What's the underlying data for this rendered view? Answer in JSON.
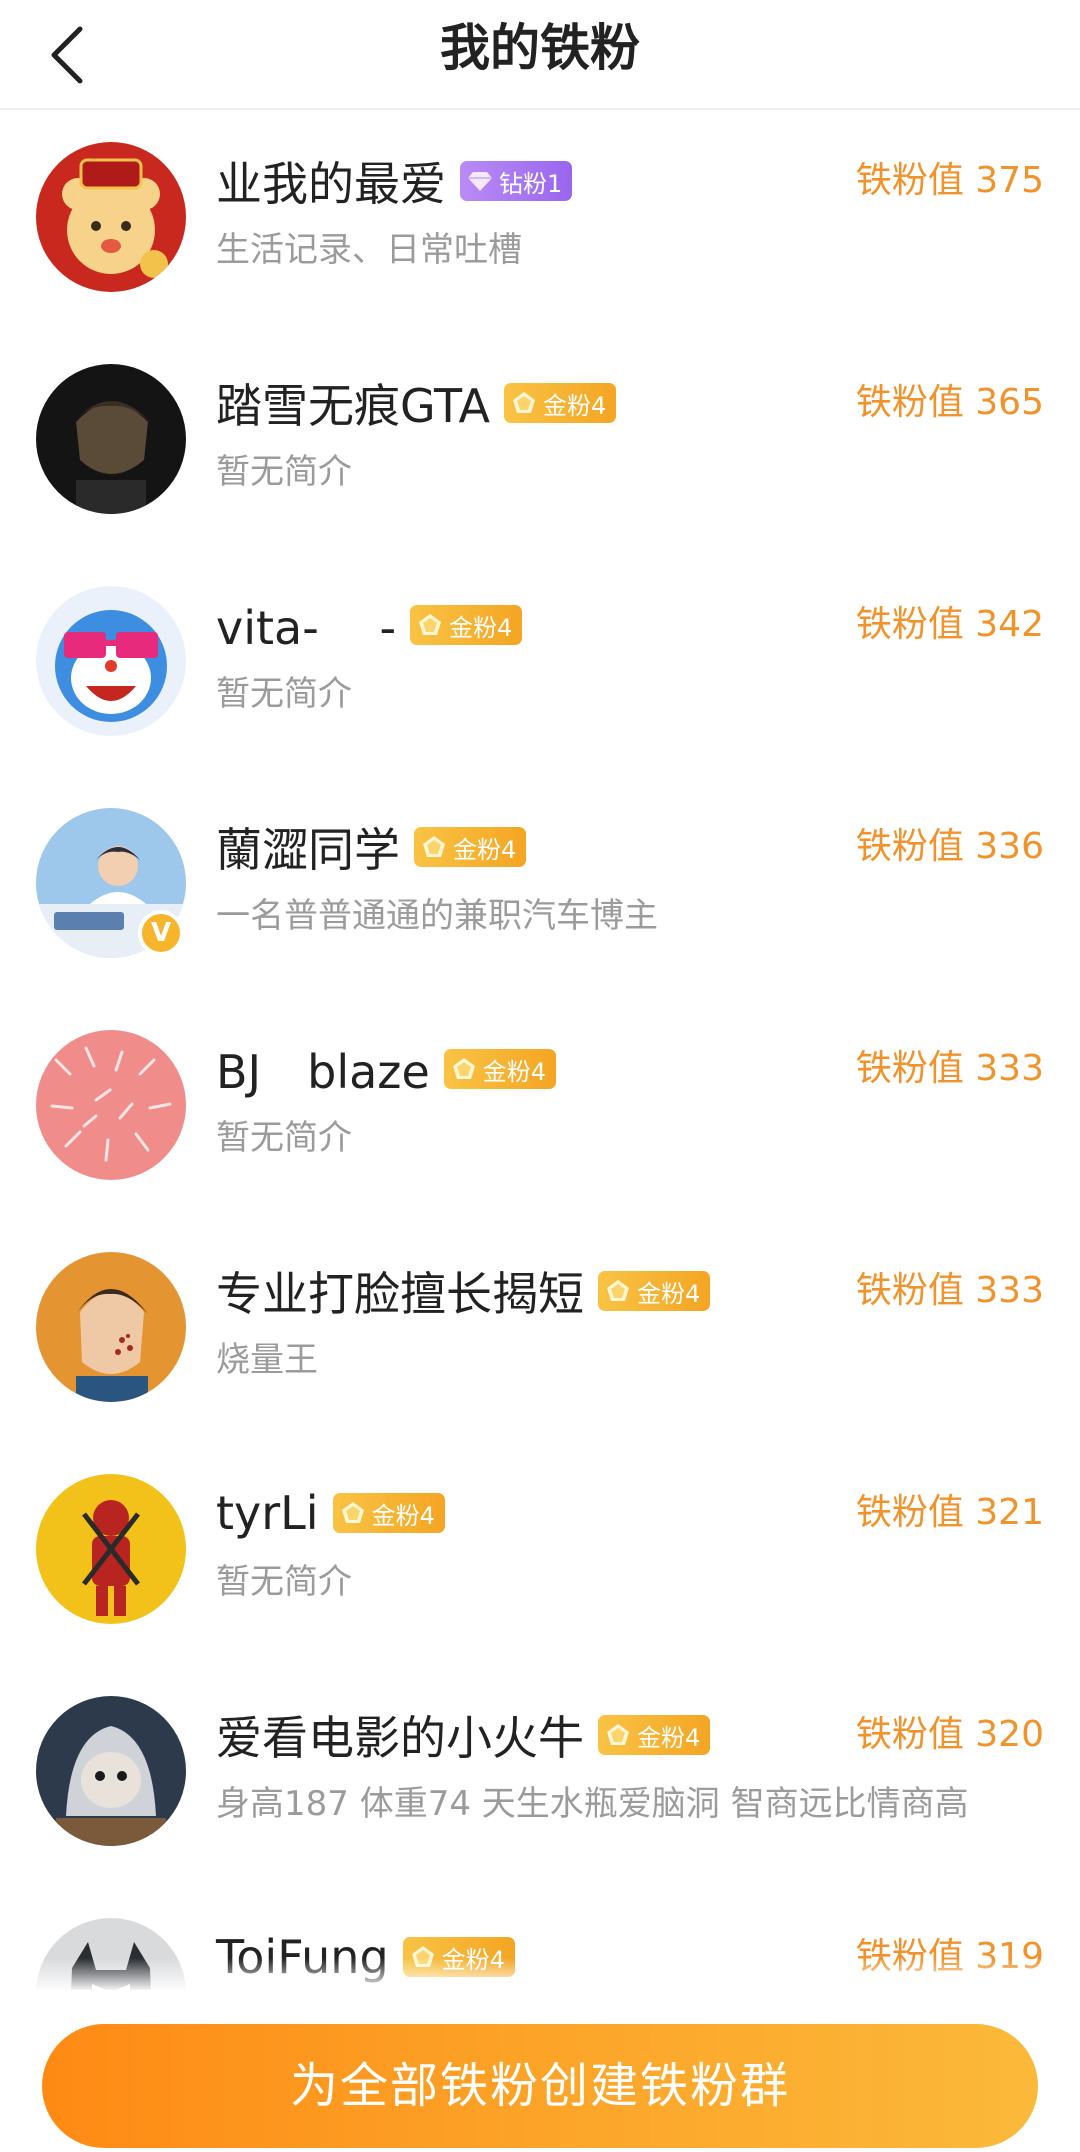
{
  "header": {
    "title": "我的铁粉"
  },
  "fans": [
    {
      "name": "业我的最爱",
      "badge": "钻粉1",
      "badge_type": "diamond",
      "bio": "生活记录、日常吐槽",
      "score": "铁粉值 375",
      "avatar": "lucky-bear-avatar"
    },
    {
      "name": "踏雪无痕GTA",
      "badge": "金粉4",
      "badge_type": "gold",
      "bio": "暂无简介",
      "score": "铁粉值 365",
      "avatar": "anime-man-avatar"
    },
    {
      "name": "vita-　 -",
      "badge": "金粉4",
      "badge_type": "gold",
      "bio": "暂无简介",
      "score": "铁粉值 342",
      "avatar": "doraemon-avatar"
    },
    {
      "name": "蘭澀同学",
      "badge": "金粉4",
      "badge_type": "gold",
      "bio": "一名普普通通的兼职汽车博主",
      "score": "铁粉值 336",
      "avatar": "student-avatar",
      "verified": "V"
    },
    {
      "name": "BJ　blaze",
      "badge": "金粉4",
      "badge_type": "gold",
      "bio": "暂无简介",
      "score": "铁粉值 333",
      "avatar": "pink-coral-avatar"
    },
    {
      "name": "专业打脸擅长揭短",
      "badge": "金粉4",
      "badge_type": "gold",
      "bio": "烧量王",
      "score": "铁粉值 333",
      "avatar": "slapped-man-avatar"
    },
    {
      "name": "tyrLi",
      "badge": "金粉4",
      "badge_type": "gold",
      "bio": "暂无简介",
      "score": "铁粉值 321",
      "avatar": "deadpool-avatar"
    },
    {
      "name": "爱看电影的小火牛",
      "badge": "金粉4",
      "badge_type": "gold",
      "bio": "身高187 体重74 天生水瓶爱脑洞 智商远比情商高",
      "score": "铁粉值 320",
      "avatar": "hooded-creature-avatar"
    },
    {
      "name": "ToiFung",
      "badge": "金粉4",
      "badge_type": "gold",
      "bio": "",
      "score": "铁粉值 319",
      "avatar": "batman-avatar"
    }
  ],
  "bottom": {
    "button_label": "为全部铁粉创建铁粉群"
  },
  "colors": {
    "accent": "#f1922a",
    "gold_badge": "#f4a523",
    "diamond_badge": "#9966ee",
    "button": "#fe8a14"
  }
}
